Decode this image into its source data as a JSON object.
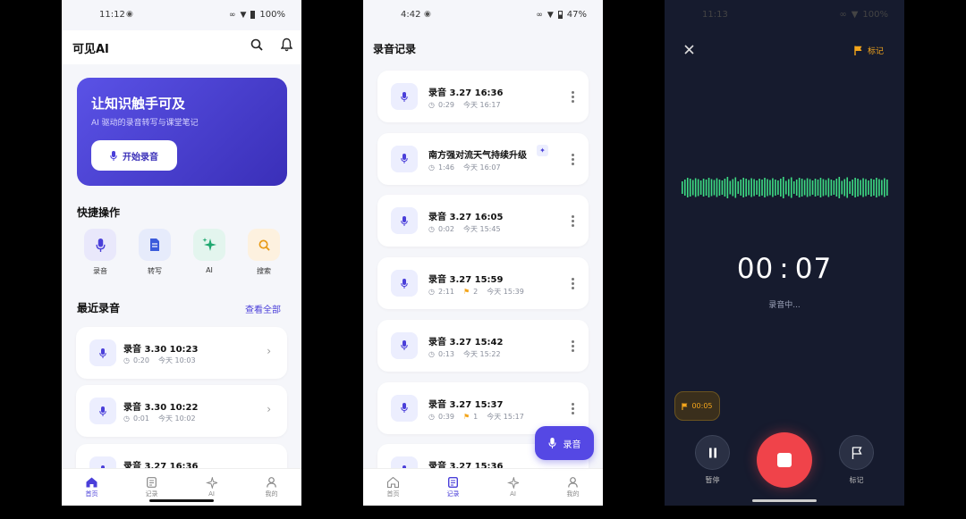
{
  "p1": {
    "status": {
      "time": "11:12",
      "battery": "100%"
    },
    "app_title": "可见AI",
    "hero": {
      "title": "让知识触手可及",
      "subtitle": "AI 驱动的录音转写与课堂笔记",
      "button": "开始录音"
    },
    "quick_title": "快捷操作",
    "quick": [
      {
        "label": "录音",
        "icon": "mic-icon",
        "bg": "#e9e8fb",
        "fg": "#4a3fd9"
      },
      {
        "label": "转写",
        "icon": "document-icon",
        "bg": "#e6ebfb",
        "fg": "#3b5bdb"
      },
      {
        "label": "AI",
        "icon": "sparkle-icon",
        "bg": "#e3f5ee",
        "fg": "#1fa870"
      },
      {
        "label": "搜索",
        "icon": "search-icon",
        "bg": "#fdf1df",
        "fg": "#e89a16"
      }
    ],
    "recent_title": "最近录音",
    "view_all": "查看全部",
    "recent": [
      {
        "title": "录音 3.30 10:23",
        "duration": "0:20",
        "date": "今天 10:03"
      },
      {
        "title": "录音 3.30 10:22",
        "duration": "0:01",
        "date": "今天 10:02"
      },
      {
        "title": "录音 3.27 16:36"
      }
    ],
    "nav": [
      "首页",
      "记录",
      "AI",
      "我的"
    ]
  },
  "p2": {
    "status": {
      "time": "4:42",
      "battery": "47%"
    },
    "title": "录音记录",
    "records": [
      {
        "title": "录音 3.27 16:36",
        "duration": "0:29",
        "date": "今天 16:17",
        "flags": "",
        "ai": false
      },
      {
        "title": "南方强对流天气持续升级",
        "duration": "1:46",
        "date": "今天 16:07",
        "flags": "",
        "ai": true
      },
      {
        "title": "录音 3.27 16:05",
        "duration": "0:02",
        "date": "今天 15:45",
        "flags": "",
        "ai": false
      },
      {
        "title": "录音 3.27 15:59",
        "duration": "2:11",
        "date": "今天 15:39",
        "flags": "2",
        "ai": false
      },
      {
        "title": "录音 3.27 15:42",
        "duration": "0:13",
        "date": "今天 15:22",
        "flags": "",
        "ai": false
      },
      {
        "title": "录音 3.27 15:37",
        "duration": "0:39",
        "date": "今天 15:17",
        "flags": "1",
        "ai": false
      },
      {
        "title": "录音 3.27 15:36"
      }
    ],
    "fab": "录音",
    "nav": [
      "首页",
      "记录",
      "AI",
      "我的"
    ]
  },
  "p3": {
    "status": {
      "time": "11:13",
      "battery": "100%"
    },
    "mark_top": "标记",
    "timer": {
      "min": "00",
      "sec": "07"
    },
    "status_text": "录音中...",
    "marker_chip": "00:05",
    "pause_label": "暂停",
    "mark_label": "标记"
  },
  "colors": {
    "accent": "#4a3fd9",
    "wave": "#3ddc84",
    "stop": "#f0434a",
    "flag": "#f3a51b"
  }
}
